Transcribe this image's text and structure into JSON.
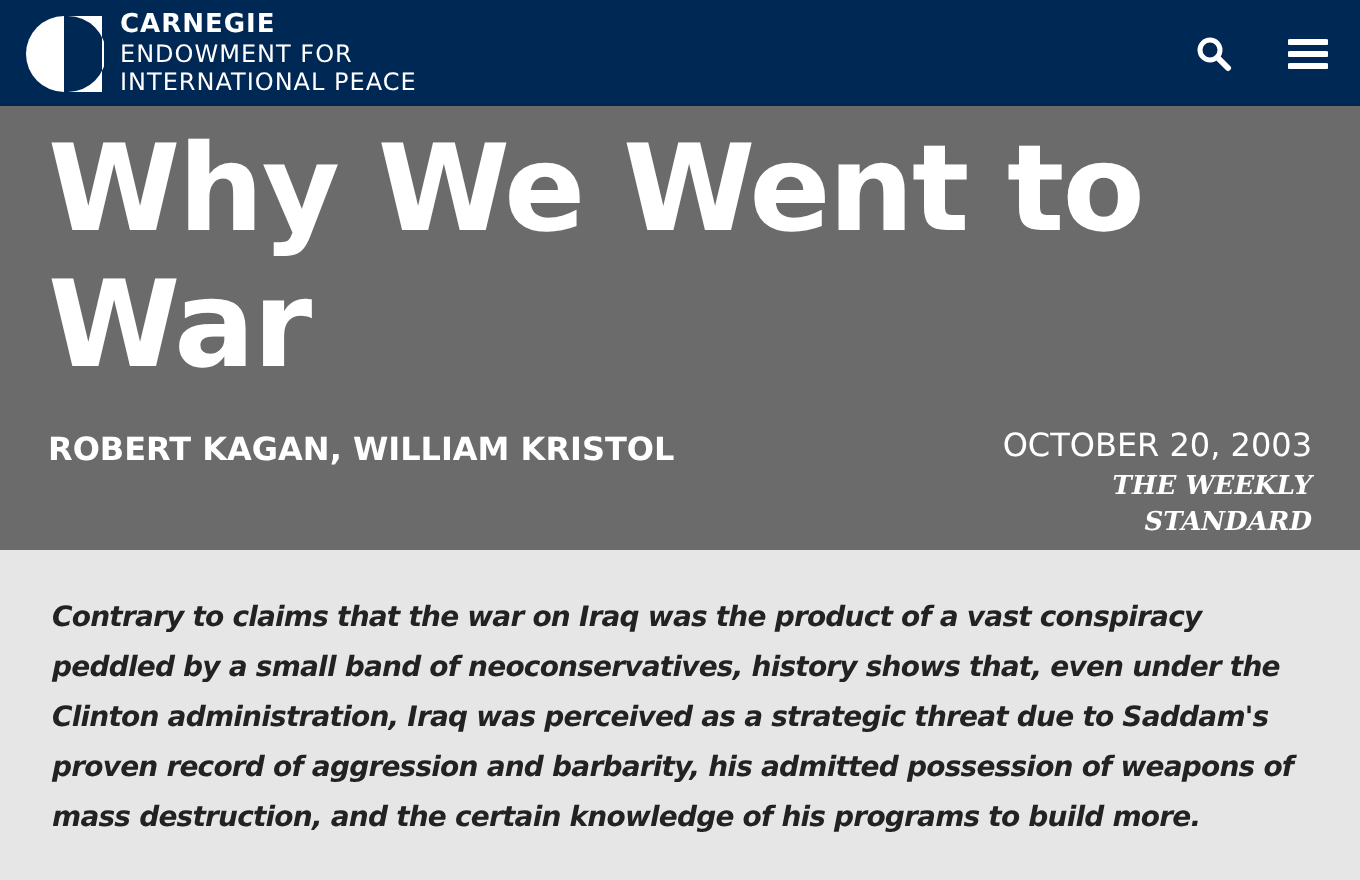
{
  "header": {
    "logo": {
      "name": "CARNEGIE",
      "line_2": "ENDOWMENT FOR",
      "line_3": "INTERNATIONAL PEACE"
    }
  },
  "article": {
    "title": "Why We Went to War",
    "authors": "ROBERT KAGAN,  WILLIAM KRISTOL",
    "date": "OCTOBER 20, 2003",
    "publication": "THE WEEKLY STANDARD"
  },
  "summary": "Contrary to claims that the war on Iraq was the product of a vast conspiracy peddled by a small band of neoconservatives, history shows that, even under the Clinton administration, Iraq was perceived as a strategic threat due to Saddam's proven record of aggression and barbarity, his admitted possession of weapons of mass destruction, and the certain knowledge of his programs to build more."
}
